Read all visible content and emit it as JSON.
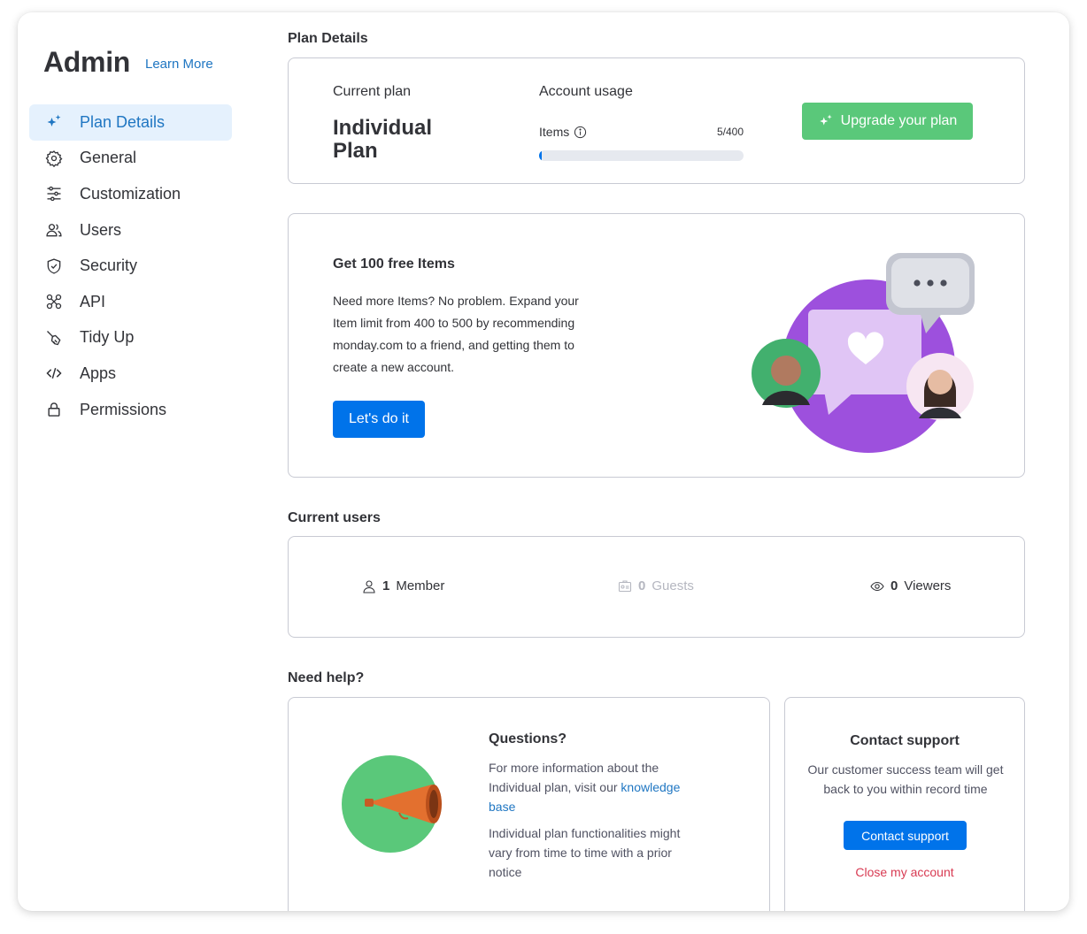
{
  "sidebar": {
    "title": "Admin",
    "learn_more": "Learn More",
    "items": [
      {
        "label": "Plan Details",
        "icon": "sparkle-icon",
        "active": true
      },
      {
        "label": "General",
        "icon": "gear-icon"
      },
      {
        "label": "Customization",
        "icon": "sliders-icon"
      },
      {
        "label": "Users",
        "icon": "users-icon"
      },
      {
        "label": "Security",
        "icon": "shield-icon"
      },
      {
        "label": "API",
        "icon": "api-icon"
      },
      {
        "label": "Tidy Up",
        "icon": "broom-icon"
      },
      {
        "label": "Apps",
        "icon": "code-icon"
      },
      {
        "label": "Permissions",
        "icon": "lock-icon"
      }
    ]
  },
  "plan": {
    "section_title": "Plan Details",
    "current_plan_label": "Current plan",
    "current_plan_name": "Individual Plan",
    "account_usage_label": "Account usage",
    "items_label": "Items",
    "items_count": "5/400",
    "items_used": 5,
    "items_limit": 400,
    "upgrade_button": "Upgrade your plan"
  },
  "referral": {
    "title": "Get 100 free Items",
    "text": "Need more Items? No problem. Expand your Item limit from 400 to 500 by recommending monday.com to a friend, and getting them to create a new account.",
    "button": "Let's do it"
  },
  "users": {
    "section_title": "Current users",
    "members_count": "1",
    "members_label": "Member",
    "guests_count": "0",
    "guests_label": "Guests",
    "viewers_count": "0",
    "viewers_label": "Viewers"
  },
  "help": {
    "section_title": "Need help?",
    "questions_title": "Questions?",
    "questions_text_prefix": "For more information about the Individual plan, visit our ",
    "questions_link": "knowledge base",
    "questions_text2": "Individual plan functionalities might vary from time to time with a prior notice",
    "contact_title": "Contact support",
    "contact_text": "Our customer success team will get back to you within record time",
    "contact_button": "Contact support",
    "close_account": "Close my account"
  },
  "colors": {
    "accent_blue": "#0073ea",
    "link_blue": "#1f76c2",
    "active_bg": "#e5f1fd",
    "success_green": "#5ac87a",
    "danger_red": "#d83a52",
    "illustration_purple": "#9b5de5"
  }
}
